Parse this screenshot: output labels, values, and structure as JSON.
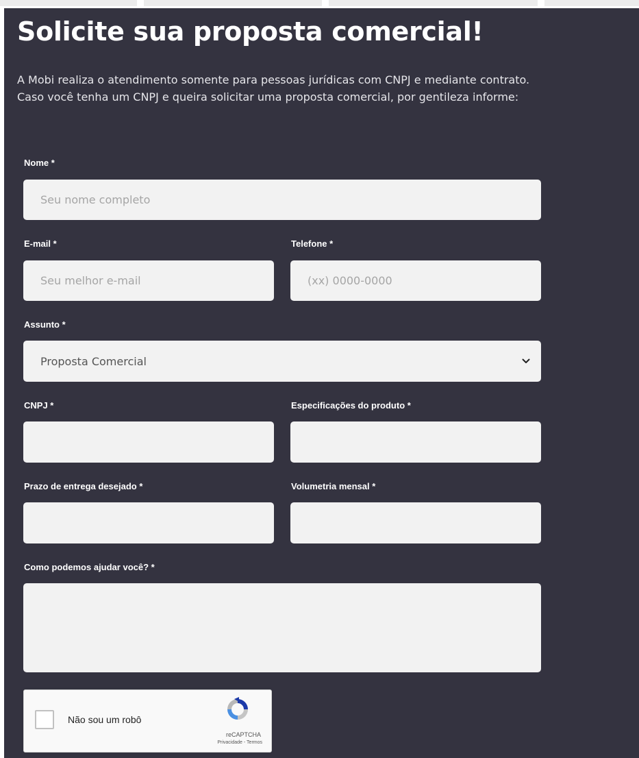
{
  "header": {
    "title": "Solicite sua proposta comercial!",
    "intro_line1": "A Mobi realiza o atendimento somente para pessoas jurídicas com CNPJ e mediante contrato.",
    "intro_line2": "Caso você tenha um CNPJ e queira solicitar uma proposta comercial, por gentileza informe:"
  },
  "form": {
    "nome": {
      "label": "Nome *",
      "placeholder": "Seu nome completo",
      "value": ""
    },
    "email": {
      "label": "E-mail *",
      "placeholder": "Seu melhor e-mail",
      "value": ""
    },
    "telefone": {
      "label": "Telefone *",
      "placeholder": "(xx) 0000-0000",
      "value": ""
    },
    "assunto": {
      "label": "Assunto *",
      "selected": "Proposta Comercial"
    },
    "cnpj": {
      "label": "CNPJ *",
      "value": ""
    },
    "especificacoes": {
      "label": "Especificações do produto *",
      "value": ""
    },
    "prazo": {
      "label": "Prazo de entrega desejado *",
      "value": ""
    },
    "volumetria": {
      "label": "Volumetria mensal *",
      "value": ""
    },
    "mensagem": {
      "label": "Como podemos ajudar você? *",
      "value": ""
    }
  },
  "recaptcha": {
    "label": "Não sou um robô",
    "brand": "reCAPTCHA",
    "privacy": "Privacidade",
    "separator": " - ",
    "terms": "Termos"
  },
  "colors": {
    "background": "#343340",
    "input_bg": "#f2f2f2",
    "text": "#ffffff"
  },
  "icons": {
    "select_arrow": "chevron-down-icon",
    "recaptcha_logo": "recaptcha-logo-icon"
  }
}
